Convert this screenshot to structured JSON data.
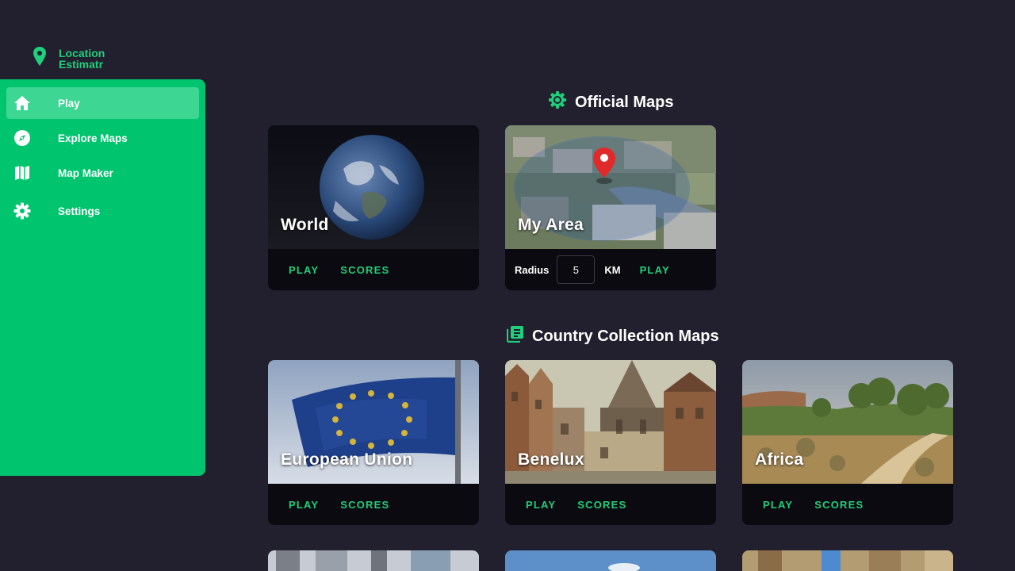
{
  "app": {
    "logo_text": "Location\nEstimatr"
  },
  "colors": {
    "accent": "#00c46e",
    "accent_text": "#1fcf7c",
    "background": "#221f2e",
    "card_footer": "#0b0a10"
  },
  "sidebar": {
    "items": [
      {
        "label": "Play",
        "icon": "home-icon",
        "active": true
      },
      {
        "label": "Explore Maps",
        "icon": "compass-icon"
      },
      {
        "label": "Map Maker",
        "icon": "map-icon"
      },
      {
        "label": "Settings",
        "icon": "gear-icon"
      }
    ]
  },
  "sections": {
    "official": {
      "title": "Official Maps",
      "icon": "settings-cog-icon",
      "cards": [
        {
          "title": "World",
          "play": "PLAY",
          "scores": "SCORES"
        },
        {
          "title": "My Area",
          "radius_label": "Radius",
          "radius_value": "5",
          "unit": "KM",
          "play": "PLAY"
        }
      ]
    },
    "country": {
      "title": "Country Collection Maps",
      "icon": "collection-icon",
      "cards": [
        {
          "title": "European Union",
          "play": "PLAY",
          "scores": "SCORES"
        },
        {
          "title": "Benelux",
          "play": "PLAY",
          "scores": "SCORES"
        },
        {
          "title": "Africa",
          "play": "PLAY",
          "scores": "SCORES"
        }
      ]
    }
  }
}
